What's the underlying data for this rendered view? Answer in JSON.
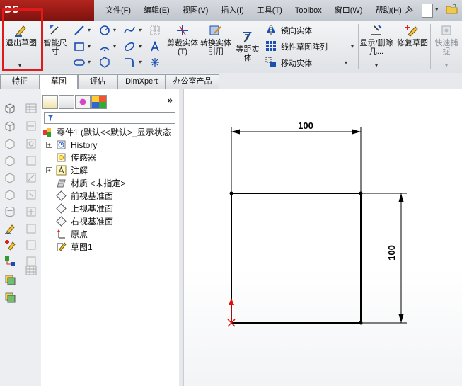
{
  "app": {
    "logo_text": "DS SOLIDWORKS"
  },
  "menu": [
    "文件(F)",
    "编辑(E)",
    "视图(V)",
    "插入(I)",
    "工具(T)",
    "Toolbox",
    "窗口(W)",
    "帮助(H)"
  ],
  "toolbar": {
    "exit_sketch": "退出草图",
    "smart_dimension": "智能尺寸",
    "trim": "剪裁实体(T)",
    "convert": "转换实体引用",
    "offset": "等距实体",
    "mirror": "镜向实体",
    "linear_pattern": "线性草图阵列",
    "move": "移动实体",
    "display_delete": "显示/删除几...",
    "repair": "修复草图",
    "quick_snap": "快速捕捉"
  },
  "tabs": [
    "特征",
    "草图",
    "评估",
    "DimXpert",
    "办公室产品"
  ],
  "active_tab_index": 1,
  "feature_tree": {
    "root": "零件1 (默认<<默认>_显示状态",
    "items": [
      {
        "label": "History",
        "expandable": true,
        "icon": "history-icon"
      },
      {
        "label": "传感器",
        "expandable": false,
        "icon": "sensor-icon"
      },
      {
        "label": "注解",
        "expandable": true,
        "icon": "annotation-icon"
      },
      {
        "label": "材质 <未指定>",
        "expandable": false,
        "icon": "material-icon"
      },
      {
        "label": "前视基准面",
        "expandable": false,
        "icon": "plane-icon"
      },
      {
        "label": "上视基准面",
        "expandable": false,
        "icon": "plane-icon"
      },
      {
        "label": "右视基准面",
        "expandable": false,
        "icon": "plane-icon"
      },
      {
        "label": "原点",
        "expandable": false,
        "icon": "origin-icon"
      },
      {
        "label": "草图1",
        "expandable": false,
        "icon": "sketch-icon"
      }
    ]
  },
  "sketch": {
    "width_dimension": "100",
    "height_dimension": "100",
    "colors": {
      "line": "#000000",
      "origin": "#e01010",
      "dim": "#000000"
    }
  }
}
